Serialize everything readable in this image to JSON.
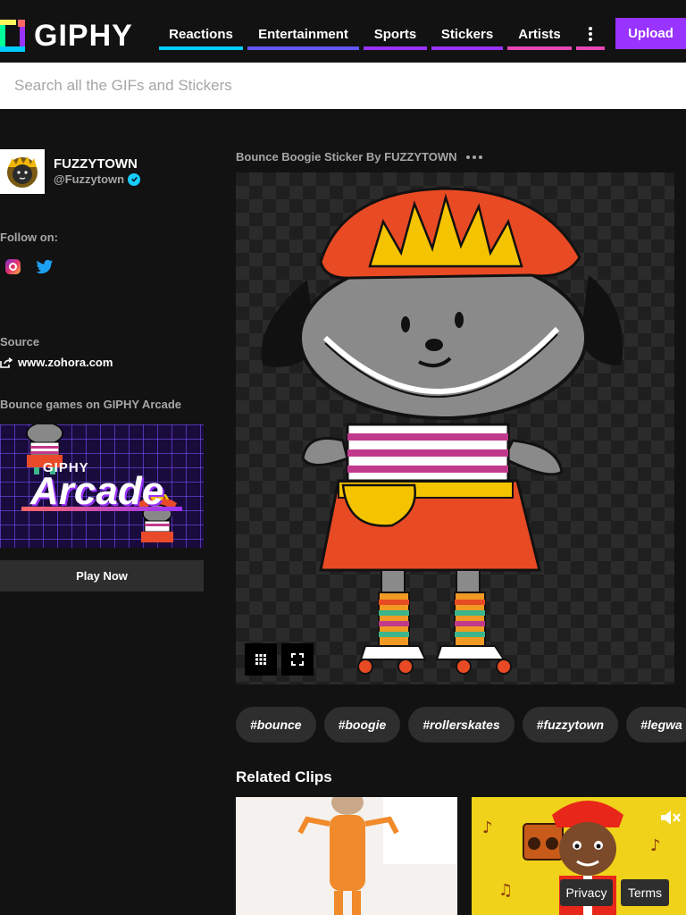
{
  "header": {
    "logo_text": "GIPHY",
    "nav": [
      {
        "label": "Reactions",
        "color": "#00ccff"
      },
      {
        "label": "Entertainment",
        "color": "#6157ff"
      },
      {
        "label": "Sports",
        "color": "#9933ff"
      },
      {
        "label": "Stickers",
        "color": "#9933ff"
      },
      {
        "label": "Artists",
        "color": "#e646b6"
      }
    ],
    "more_icon": "vertical-dots-icon",
    "more_color": "#e646b6",
    "upload_label": "Upload",
    "upload_color": "#9933ff"
  },
  "search": {
    "placeholder": "Search all the GIFs and Stickers"
  },
  "creator": {
    "name": "FUZZYTOWN",
    "handle": "@Fuzzytown",
    "verified_icon": "verified-check-icon",
    "follow_label": "Follow on:",
    "social_icons": [
      "instagram-icon",
      "twitter-icon"
    ],
    "source_label": "Source",
    "source_url": "www.zohora.com",
    "source_icon": "share-arrow-icon"
  },
  "arcade": {
    "heading": "Bounce games on GIPHY Arcade",
    "brand": "GIPHY",
    "title": "Arcade",
    "play_label": "Play Now"
  },
  "gif": {
    "title": "Bounce Boogie Sticker By FUZZYTOWN",
    "more_icon": "horizontal-dots-icon",
    "buttons": [
      "grid-icon",
      "fullscreen-icon"
    ]
  },
  "tags": [
    "#bounce",
    "#boogie",
    "#rollerskates",
    "#fuzzytown",
    "#legwa"
  ],
  "related": {
    "heading": "Related Clips",
    "mute_icon": "muted-speaker-icon"
  },
  "footer": {
    "privacy": "Privacy",
    "terms": "Terms"
  }
}
